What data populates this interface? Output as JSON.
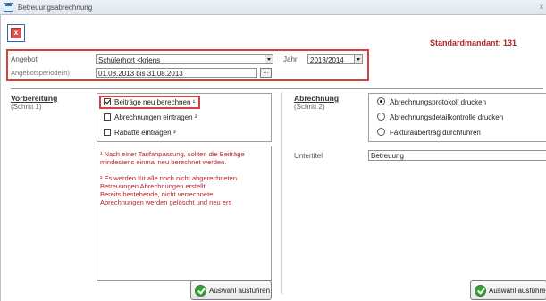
{
  "window": {
    "title": "Betreuungsabrechnung",
    "close_glyph": "x"
  },
  "toolbar": {
    "exit_glyph": "x",
    "exit_icon": "close-red-icon"
  },
  "header": {
    "mandant": "Standardmandant: 131"
  },
  "filter": {
    "angebot_label": "Angebot",
    "angebot_value": "Schülerhort <kriens",
    "jahr_label": "Jahr",
    "jahr_value": "2013/2014",
    "periode_label": "Angebotsperiode(n)",
    "periode_value": "01.08.2013 bis 31.08.2013",
    "periode_button": "..."
  },
  "vorbereitung": {
    "title": "Vorbereitung",
    "subtitle": "(Schritt 1)",
    "options": [
      {
        "label": "Beiträge neu berechnen ¹",
        "checked": true
      },
      {
        "label": "Abrechnungen eintragen ²",
        "checked": false
      },
      {
        "label": "Rabatte eintragen ³",
        "checked": false
      }
    ],
    "notes": [
      "¹ Nach einer Tarifanpassung, sollten die Beiträge",
      "mindestens einmal neu berechnet werden.",
      "",
      "² Es werden für alle noch nicht abgerechneten",
      "Betreuungen Abrechnungen erstellt.",
      "Bereits bestehende, nicht verrechnete",
      "Abrechnungen werden gelöscht und neu ers"
    ],
    "run_button": "Auswahl ausführen"
  },
  "abrechnung": {
    "title": "Abrechnung",
    "subtitle": "(Schritt 2)",
    "options": [
      {
        "label": "Abrechnungsprotokoll drucken",
        "selected": true
      },
      {
        "label": "Abrechnungsdetailkontrolle drucken",
        "selected": false
      },
      {
        "label": "Fakturaübertrag durchführen",
        "selected": false
      }
    ],
    "untertitel_label": "Untertitel",
    "untertitel_value": "Betreuung",
    "run_button": "Auswahl ausführen"
  },
  "colors": {
    "accent_red": "#b32020",
    "highlight": "#d84040",
    "note_red": "#b72424"
  }
}
